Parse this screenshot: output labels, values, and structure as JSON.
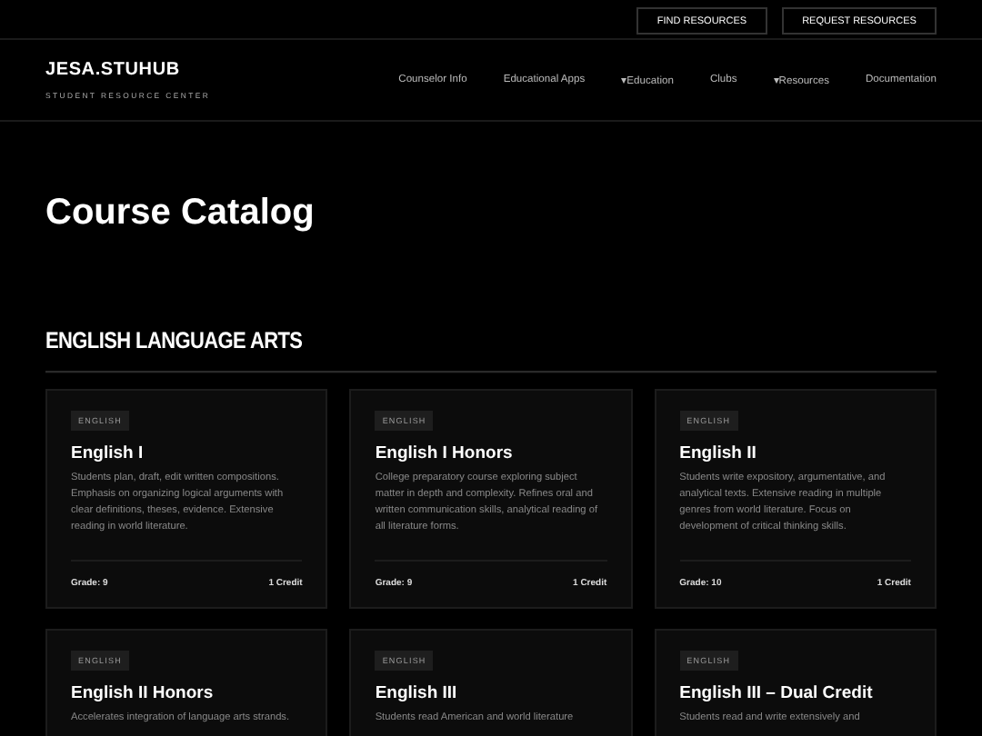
{
  "top_buttons": [
    "FIND RESOURCES",
    "REQUEST RESOURCES"
  ],
  "brand": {
    "title": "JESA.STUHUB",
    "subtitle": "STUDENT RESOURCE CENTER"
  },
  "nav": [
    {
      "label": "Counselor Info",
      "dropdown": false
    },
    {
      "label": "Educational Apps",
      "dropdown": false
    },
    {
      "label": "Education",
      "dropdown": true
    },
    {
      "label": "Clubs",
      "dropdown": false
    },
    {
      "label": "Resources",
      "dropdown": true
    },
    {
      "label": "Documentation",
      "dropdown": false
    }
  ],
  "nav_caret": "▾",
  "page_title": "Course Catalog",
  "section": {
    "title": "ENGLISH LANGUAGE ARTS",
    "courses": [
      {
        "tag": "ENGLISH",
        "title": "English I",
        "description": "Students plan, draft, edit written compositions. Emphasis on organizing logical arguments with clear definitions, theses, evidence. Extensive reading in world literature.",
        "grade": "Grade: 9",
        "credit": "1 Credit"
      },
      {
        "tag": "ENGLISH",
        "title": "English I Honors",
        "description": "College preparatory course exploring subject matter in depth and complexity. Refines oral and written communication skills, analytical reading of all literature forms.",
        "grade": "Grade: 9",
        "credit": "1 Credit"
      },
      {
        "tag": "ENGLISH",
        "title": "English II",
        "description": "Students write expository, argumentative, and analytical texts. Extensive reading in multiple genres from world literature. Focus on development of critical thinking skills.",
        "grade": "Grade: 10",
        "credit": "1 Credit"
      },
      {
        "tag": "ENGLISH",
        "title": "English II Honors",
        "description": "Accelerates integration of language arts strands."
      },
      {
        "tag": "ENGLISH",
        "title": "English III",
        "description": "Students read American and world literature"
      },
      {
        "tag": "ENGLISH",
        "title": "English III – Dual Credit",
        "description": "Students read and write extensively and"
      }
    ]
  }
}
